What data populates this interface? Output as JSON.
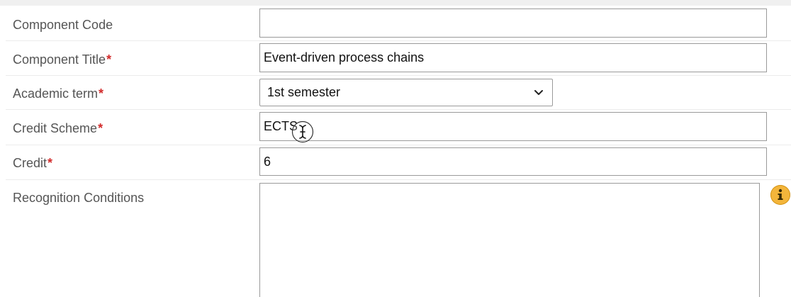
{
  "form": {
    "rows": [
      {
        "label": "Component Code",
        "required": false,
        "type": "text",
        "value": ""
      },
      {
        "label": "Component Title",
        "required": true,
        "type": "text",
        "value": "Event-driven process chains"
      },
      {
        "label": "Academic term",
        "required": true,
        "type": "select",
        "value": "1st semester"
      },
      {
        "label": "Credit Scheme",
        "required": true,
        "type": "text",
        "value": "ECTS"
      },
      {
        "label": "Credit",
        "required": true,
        "type": "text",
        "value": "6"
      },
      {
        "label": "Recognition Conditions",
        "required": false,
        "type": "textarea",
        "value": ""
      }
    ],
    "required_marker": "*"
  },
  "icons": {
    "info": "info-icon",
    "select_chevron": "chevron-down-icon",
    "text_cursor": "text-cursor-icon"
  },
  "colors": {
    "required_marker": "#d22b2b",
    "info_icon": "#f3b53b",
    "label_text": "#555555",
    "field_border": "#9a9a9a"
  }
}
